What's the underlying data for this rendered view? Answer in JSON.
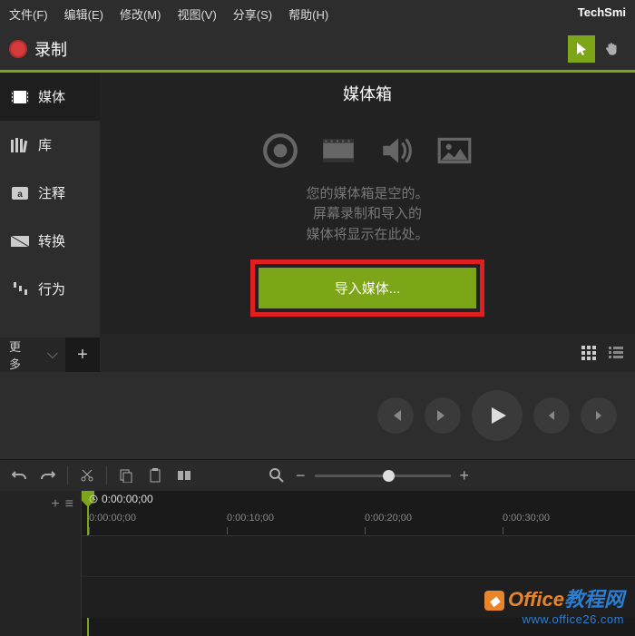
{
  "menu": {
    "file": "文件(F)",
    "edit": "编辑(E)",
    "modify": "修改(M)",
    "view": "视图(V)",
    "share": "分享(S)",
    "help": "帮助(H)",
    "brand": "TechSmi"
  },
  "record": {
    "label": "录制"
  },
  "sidebar": {
    "items": [
      {
        "label": "媒体"
      },
      {
        "label": "库"
      },
      {
        "label": "注释"
      },
      {
        "label": "转换"
      },
      {
        "label": "行为"
      }
    ],
    "more": "更多"
  },
  "panel": {
    "title": "媒体箱",
    "empty_line1": "您的媒体箱是空的。",
    "empty_line2": "屏幕录制和导入的",
    "empty_line3": "媒体将显示在此处。",
    "import_btn": "导入媒体..."
  },
  "timeline": {
    "current": "0:00:00;00",
    "ticks": [
      "0:00:00;00",
      "0:00:10;00",
      "0:00:20;00",
      "0:00:30;00"
    ]
  },
  "toolbar": {
    "minus": "−",
    "plus": "+"
  },
  "watermark": {
    "title1": "Office",
    "title2": "教程网",
    "url": "www.office26.com"
  }
}
